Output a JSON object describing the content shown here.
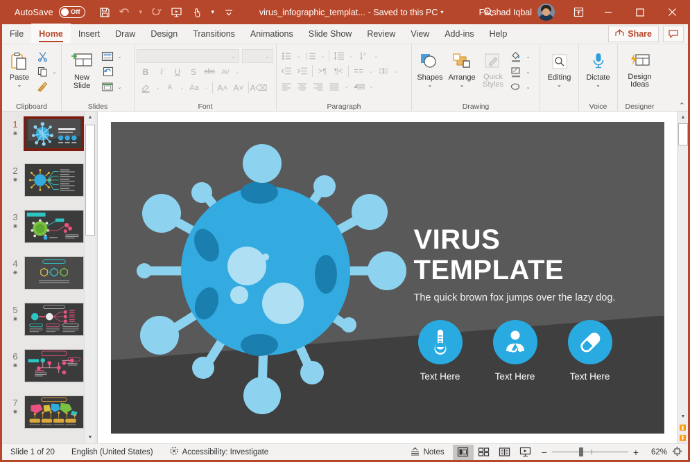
{
  "titlebar": {
    "autosave_label": "AutoSave",
    "autosave_state": "Off",
    "save_icon": "save-icon",
    "undo_icon": "undo-icon",
    "redo_icon": "redo-icon",
    "present_icon": "start-presentation-icon",
    "touch_icon": "touch-mode-icon",
    "more_icon": "customize-quick-access-icon",
    "filename": "virus_infographic_templat...",
    "saved_status": "- Saved to this PC",
    "search_icon": "search-icon",
    "user_name": "Farshad Iqbal",
    "avatar": "user-avatar",
    "ribbon_display_icon": "ribbon-display-options-icon",
    "minimize": "minimize-icon",
    "maximize": "maximize-icon",
    "close": "close-icon",
    "accent_color": "#b7472a"
  },
  "tabs": [
    {
      "label": "File",
      "active": false
    },
    {
      "label": "Home",
      "active": true
    },
    {
      "label": "Insert",
      "active": false
    },
    {
      "label": "Draw",
      "active": false
    },
    {
      "label": "Design",
      "active": false
    },
    {
      "label": "Transitions",
      "active": false
    },
    {
      "label": "Animations",
      "active": false
    },
    {
      "label": "Slide Show",
      "active": false
    },
    {
      "label": "Review",
      "active": false
    },
    {
      "label": "View",
      "active": false
    },
    {
      "label": "Add-ins",
      "active": false
    },
    {
      "label": "Help",
      "active": false
    }
  ],
  "tab_actions": {
    "share_label": "Share",
    "share_icon": "share-icon",
    "comments_icon": "comments-icon"
  },
  "ribbon": {
    "collapse_icon": "collapse-ribbon-icon",
    "groups": [
      {
        "name": "Clipboard",
        "title": "Clipboard",
        "paste_label": "Paste",
        "cut_icon": "cut-scissors-icon",
        "copy_icon": "copy-icon",
        "format_painter_icon": "format-painter-icon",
        "launcher_icon": "dialog-launcher-icon"
      },
      {
        "name": "Slides",
        "title": "Slides",
        "new_slide_label": "New Slide",
        "layout_icon": "slide-layout-icon",
        "reset_icon": "reset-slide-icon",
        "section_icon": "section-icon"
      },
      {
        "name": "Font",
        "title": "Font",
        "font_name_value": "",
        "font_size_value": "",
        "bold": "B",
        "italic": "I",
        "underline": "U",
        "shadow": "S",
        "strikethrough": "abc",
        "char_spacing": "AV",
        "text_highlight_icon": "text-highlight-icon",
        "font_color_icon": "font-color-icon",
        "change_case": "Aa",
        "increase_size": "A",
        "decrease_size": "A",
        "clear_formatting_icon": "clear-formatting-icon",
        "launcher_icon": "dialog-launcher-icon"
      },
      {
        "name": "Paragraph",
        "title": "Paragraph",
        "bullets_icon": "bullets-icon",
        "numbering_icon": "numbering-icon",
        "line_spacing_icon": "line-spacing-icon",
        "text_direction_icon": "text-direction-icon",
        "decrease_indent_icon": "decrease-indent-icon",
        "increase_indent_icon": "increase-indent-icon",
        "rtl_icon": "right-to-left-icon",
        "ltr_icon": "left-to-right-icon",
        "columns_icon": "columns-icon",
        "align_text_icon": "align-text-icon",
        "align_left_icon": "align-left-icon",
        "align_center_icon": "align-center-icon",
        "align_right_icon": "align-right-icon",
        "justify_icon": "justify-icon",
        "smartart_icon": "convert-to-smartart-icon",
        "launcher_icon": "dialog-launcher-icon"
      },
      {
        "name": "Drawing",
        "title": "Drawing",
        "shapes_label": "Shapes",
        "arrange_label": "Arrange",
        "quick_styles_label": "Quick Styles",
        "shape_fill_icon": "shape-fill-icon",
        "shape_outline_icon": "shape-outline-icon",
        "shape_effects_icon": "shape-effects-icon",
        "launcher_icon": "dialog-launcher-icon"
      },
      {
        "name": "Editing",
        "title": "",
        "editing_label": "Editing",
        "editing_icon": "find-magnifier-icon"
      },
      {
        "name": "Voice",
        "title": "Voice",
        "dictate_label": "Dictate",
        "dictate_icon": "microphone-icon"
      },
      {
        "name": "Designer",
        "title": "Designer",
        "design_ideas_label": "Design Ideas",
        "design_ideas_icon": "design-ideas-icon"
      }
    ]
  },
  "thumbnails": {
    "scroll_up_icon": "scroll-up-icon",
    "scroll_down_icon": "scroll-down-icon",
    "slides": [
      {
        "number": "1",
        "star": "animation-star-icon",
        "selected": true,
        "kind": "title"
      },
      {
        "number": "2",
        "star": "animation-star-icon",
        "selected": false,
        "kind": "radial-list"
      },
      {
        "number": "3",
        "star": "animation-star-icon",
        "selected": false,
        "kind": "green-virus"
      },
      {
        "number": "4",
        "star": "animation-star-icon",
        "selected": false,
        "kind": "hex-row"
      },
      {
        "number": "5",
        "star": "animation-star-icon",
        "selected": false,
        "kind": "tree"
      },
      {
        "number": "6",
        "star": "animation-star-icon",
        "selected": false,
        "kind": "flow"
      },
      {
        "number": "7",
        "star": "animation-star-icon",
        "selected": false,
        "kind": "world-map"
      }
    ]
  },
  "slide": {
    "title": "VIRUS TEMPLATE",
    "subtitle": "The quick brown fox jumps over the lazy dog.",
    "bg_color": "#595959",
    "band_color": "#3f3f3f",
    "virus_color": "#29abe2",
    "virus_light": "#8dd3f0",
    "icons": [
      {
        "label": "Text Here",
        "icon": "thermometer-icon"
      },
      {
        "label": "Text Here",
        "icon": "doctor-stethoscope-icon"
      },
      {
        "label": "Text Here",
        "icon": "pill-capsule-icon"
      }
    ]
  },
  "canvas_scroll": {
    "up_icon": "scroll-up-icon",
    "down_icon": "scroll-down-icon",
    "prev_slide_icon": "previous-slide-icon",
    "next_slide_icon": "next-slide-icon"
  },
  "statusbar": {
    "slide_counter": "Slide 1 of 20",
    "language": "English (United States)",
    "accessibility": "Accessibility: Investigate",
    "accessibility_icon": "accessibility-icon",
    "notes_label": "Notes",
    "notes_icon": "notes-icon",
    "views": [
      {
        "name": "normal-view",
        "icon": "normal-view-icon",
        "active": true
      },
      {
        "name": "slide-sorter-view",
        "icon": "slide-sorter-icon",
        "active": false
      },
      {
        "name": "reading-view",
        "icon": "reading-view-icon",
        "active": false
      },
      {
        "name": "slide-show-view",
        "icon": "slide-show-icon",
        "active": false
      }
    ],
    "zoom_out": "−",
    "zoom_in": "+",
    "zoom_level": "62%",
    "fit_icon": "fit-slide-to-window-icon"
  }
}
